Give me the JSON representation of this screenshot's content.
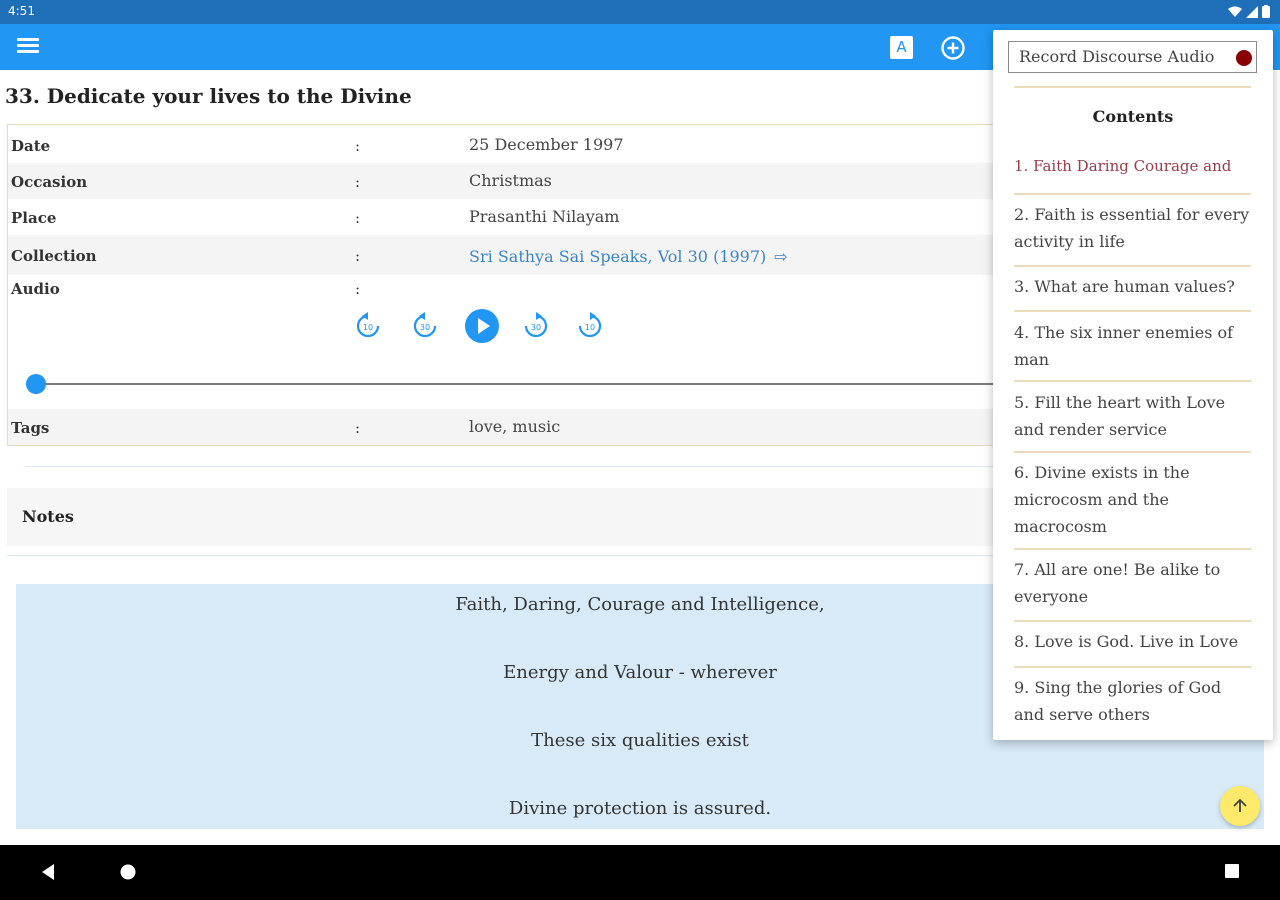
{
  "status_bar": {
    "time": "4:51"
  },
  "app_bar": {
    "font_icon_label": "A"
  },
  "discourse": {
    "title": "33. Dedicate your lives to the Divine",
    "colon": ":",
    "rows": [
      {
        "label": "Date",
        "value": "25 December 1997"
      },
      {
        "label": "Occasion",
        "value": "Christmas"
      },
      {
        "label": "Place",
        "value": "Prasanthi Nilayam"
      },
      {
        "label": "Collection",
        "value": "Sri Sathya Sai Speaks, Vol 30 (1997)"
      },
      {
        "label": "Audio",
        "value": ""
      },
      {
        "label": "Tags",
        "value": "love, music"
      }
    ],
    "audio": {
      "controls": [
        "replay-10-icon",
        "replay-30-icon",
        "play-icon",
        "forward-30-icon",
        "forward-10-icon"
      ],
      "progress": 0
    }
  },
  "notes": {
    "label": "Notes"
  },
  "poem": {
    "lines": [
      "Faith, Daring, Courage and Intelligence,",
      "Energy and Valour - wherever",
      "These six qualities exist",
      "Divine protection is assured."
    ]
  },
  "panel": {
    "record_label": "Record Discourse Audio",
    "contents_title": "Contents",
    "items": [
      "1. Faith Daring Courage and",
      "2. Faith is essential for every activity in life",
      "3. What are human values?",
      "4. The six inner enemies of man",
      "5. Fill the heart with Love and render service",
      "6. Divine exists in the microcosm and the macrocosm",
      "7. All are one! Be alike to everyone",
      "8. Love is God. Live in Love",
      "9. Sing the glories of God and serve others"
    ]
  },
  "colors": {
    "app_bar": "#2196f3",
    "status_bar": "#1f6fb8",
    "accent_link": "#3a86c8",
    "active_toc": "#9b3a4a",
    "record_dot": "#8b0000",
    "poem_bg": "#d8eaf8",
    "fab": "#fde96a"
  }
}
